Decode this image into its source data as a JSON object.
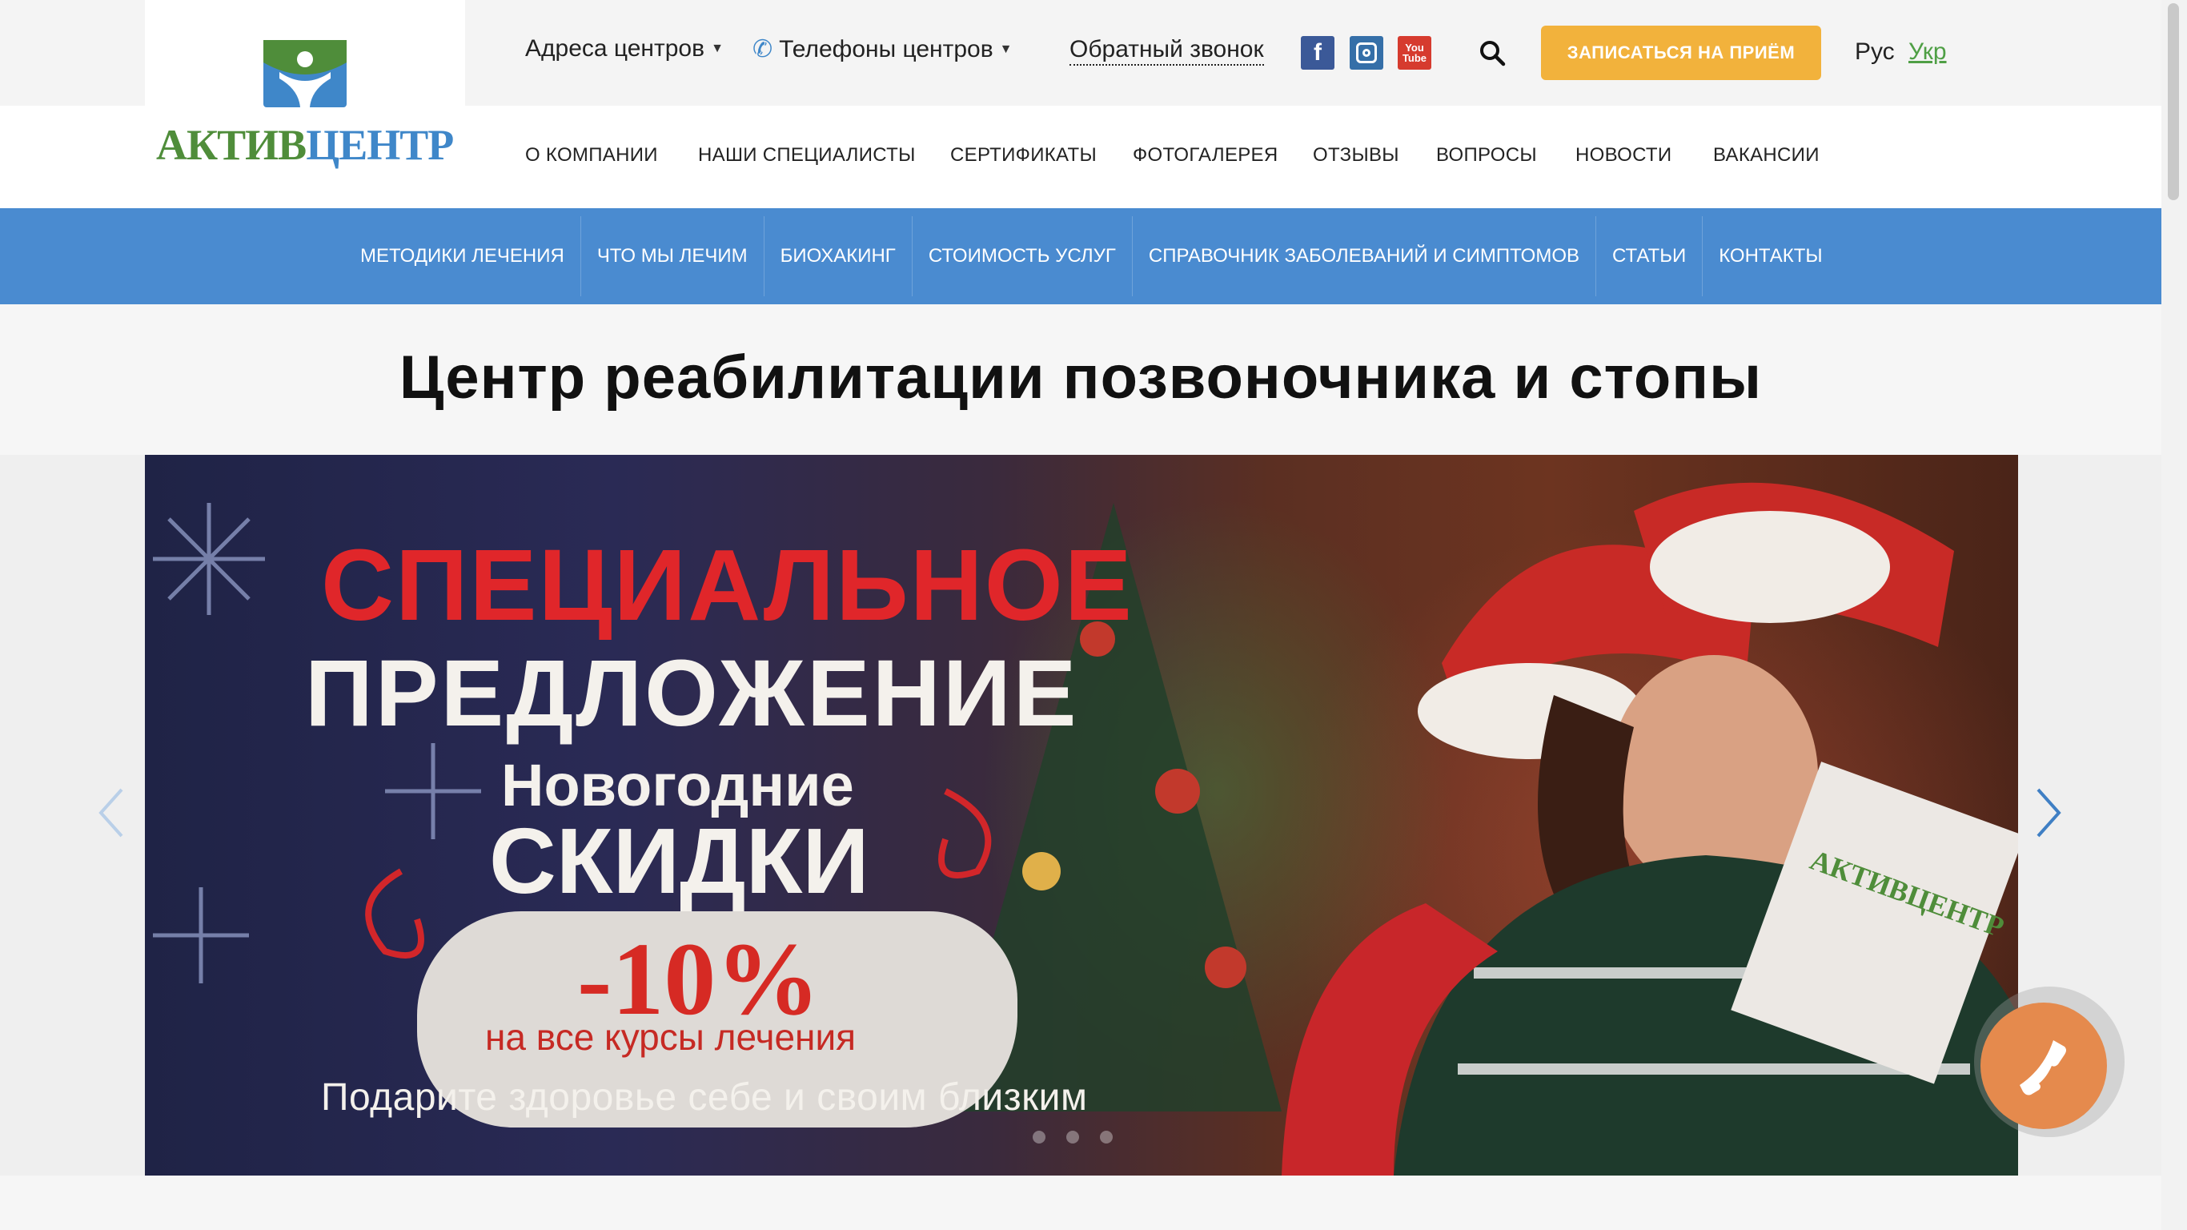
{
  "brand": {
    "logo_text_green": "АКТИВ",
    "logo_text_blue": "ЦЕНТР",
    "green": "#4f8d3a",
    "blue": "#3f87c9"
  },
  "topbar": {
    "addresses": "Адреса центров",
    "phones": "Телефоны центров",
    "callback": "Обратный звонок",
    "cta": "ЗАПИСАТЬСЯ НА ПРИЁМ",
    "lang_ru": "Рус",
    "lang_ua": "Укр",
    "social": [
      "facebook-icon",
      "instagram-icon",
      "youtube-icon"
    ]
  },
  "main_menu": [
    "О КОМПАНИИ",
    "НАШИ СПЕЦИАЛИСТЫ",
    "СЕРТИФИКАТЫ",
    "ФОТОГАЛЕРЕЯ",
    "ОТЗЫВЫ",
    "ВОПРОСЫ",
    "НОВОСТИ",
    "ВАКАНСИИ"
  ],
  "blue_menu": [
    "МЕТОДИКИ ЛЕЧЕНИЯ",
    "ЧТО МЫ ЛЕЧИМ",
    "БИОХАКИНГ",
    "СТОИМОСТЬ УСЛУГ",
    "СПРАВОЧНИК ЗАБОЛЕВАНИЙ И СИМПТОМОВ",
    "СТАТЬИ",
    "КОНТАКТЫ"
  ],
  "headline": "Центр реабилитации позвоночника и стопы",
  "banner": {
    "line1": "СПЕЦИАЛЬНОЕ",
    "line2": "ПРЕДЛОЖЕНИЕ",
    "line3": "Новогодние",
    "line4": "СКИДКИ",
    "discount": "-10%",
    "discount_note": "на все курсы лечения",
    "tagline": "Подарите здоровье себе и своим близким",
    "box_logo": "АКТИВЦЕНТР"
  },
  "colors": {
    "blue_bar": "#4a8bd0",
    "cta": "#f2b23c",
    "phone_fab": "#e58a4d",
    "promo_red": "#e0262a"
  }
}
